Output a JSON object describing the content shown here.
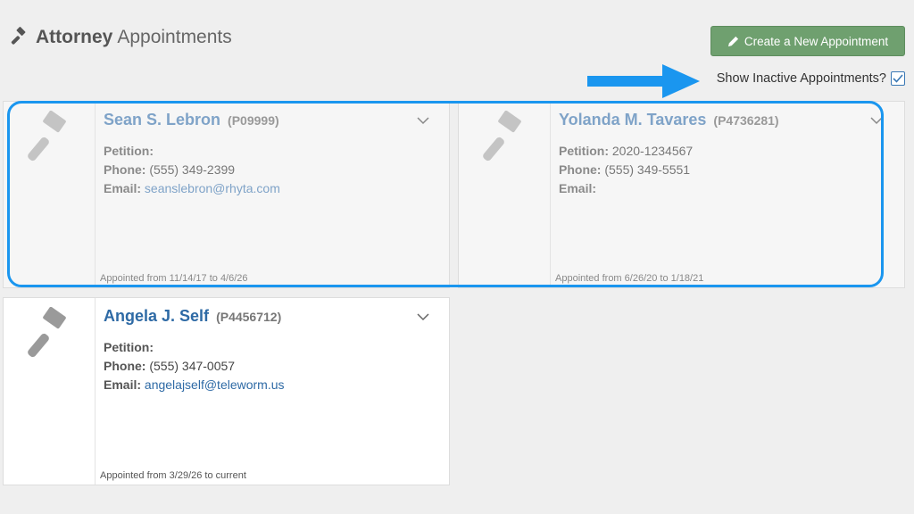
{
  "header": {
    "title_bold": "Attorney",
    "title_light": "Appointments",
    "icon": "gavel-icon"
  },
  "toolbar": {
    "create_label": "Create a New Appointment",
    "create_icon": "pencil-icon",
    "create_color": "#6fa06f",
    "show_inactive_label": "Show Inactive Appointments?",
    "show_inactive_checked": true
  },
  "labels": {
    "petition": "Petition:",
    "phone": "Phone:",
    "email": "Email:"
  },
  "cards": [
    {
      "name": "Sean S. Lebron",
      "id": "(P09999)",
      "petition": "",
      "phone": "(555) 349-2399",
      "email": "seanslebron@rhyta.com",
      "appointed": "Appointed from 11/14/17 to 4/6/26",
      "active": false
    },
    {
      "name": "Yolanda M. Tavares",
      "id": "(P4736281)",
      "petition": "2020-1234567",
      "phone": "(555) 349-5551",
      "email": "",
      "appointed": "Appointed from 6/26/20 to 1/18/21",
      "active": false
    },
    {
      "name": "Angela J. Self",
      "id": "(P4456712)",
      "petition": "",
      "phone": "(555) 347-0057",
      "email": "angelajself@teleworm.us",
      "appointed": "Appointed from 3/29/26 to current",
      "active": true
    }
  ],
  "annotation": {
    "arrow_color": "#1a96ef",
    "highlight_color": "#1a96ef"
  }
}
